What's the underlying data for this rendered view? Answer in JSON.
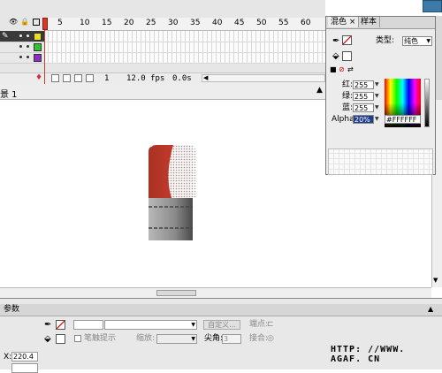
{
  "timeline": {
    "frame_numbers": [
      "5",
      "10",
      "15",
      "20",
      "25",
      "30",
      "35",
      "40",
      "45",
      "50",
      "55",
      "60"
    ],
    "layers": [
      {
        "active": true,
        "color": "#e8e020"
      },
      {
        "active": false,
        "color": "#2ec52e"
      },
      {
        "active": false,
        "color": "#8a2ec5"
      }
    ],
    "status": {
      "current_frame": "1",
      "fps": "12.0 fps",
      "time": "0.0s"
    }
  },
  "scene": {
    "label": "景 1"
  },
  "color_panel": {
    "tabs": [
      "混色",
      "样本"
    ],
    "type_label": "类型:",
    "type_value": "纯色",
    "red_label": "红:",
    "red_value": "255",
    "green_label": "绿:",
    "green_value": "255",
    "blue_label": "蓝:",
    "blue_value": "255",
    "alpha_label": "Alpha:",
    "alpha_value": "20%",
    "hex_value": "#FFFFFF"
  },
  "properties": {
    "tab": "参数",
    "custom_button": "自定义...",
    "endpoint_label": "端点:",
    "stroke_hint": "笔触提示",
    "scale_label": "缩放:",
    "miter_label": "尖角:",
    "miter_value": "3",
    "join_label": "接合:",
    "x_label": "X:",
    "x_value": "220.4"
  },
  "watermark": "HTTP: //WWW. AGAF. CN",
  "colors": {
    "playhead": "#d23a2a",
    "bottle_red": "#c0392b",
    "active_layer": "#3a3a3a"
  }
}
